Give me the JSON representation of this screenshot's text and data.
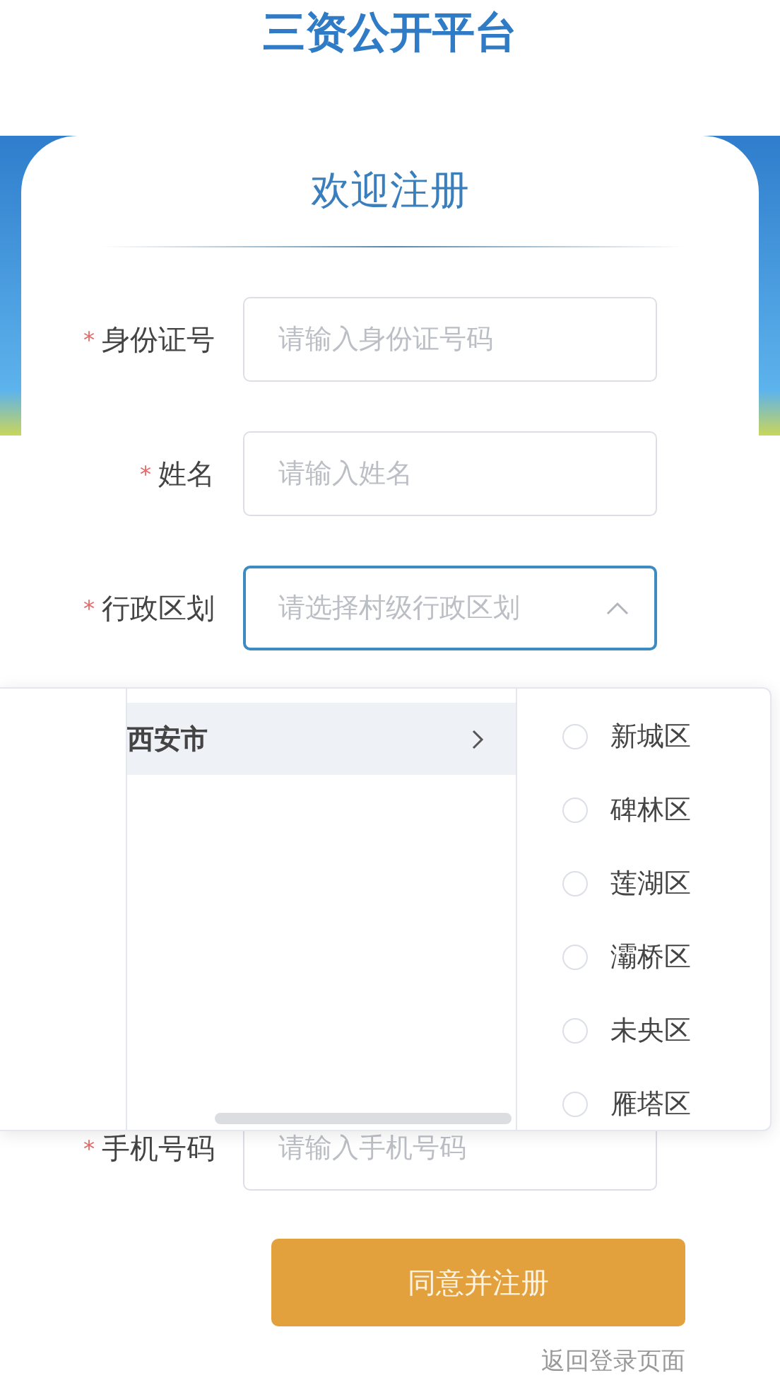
{
  "header": {
    "title": "三资公开平台"
  },
  "form": {
    "title": "欢迎注册",
    "fields": [
      {
        "label": "身份证号",
        "required_mark": "*",
        "kind": "input",
        "placeholder": "请输入身份证号码"
      },
      {
        "label": "姓名",
        "required_mark": "*",
        "kind": "input",
        "placeholder": "请输入姓名"
      },
      {
        "label": "行政区划",
        "required_mark": "*",
        "kind": "select",
        "placeholder": "请选择村级行政区划",
        "expanded": true
      },
      {
        "label": "手机号码",
        "required_mark": "*",
        "kind": "input",
        "placeholder": "请输入手机号码"
      }
    ],
    "submit": "同意并注册",
    "back_link": "返回登录页面"
  },
  "cascader": {
    "cities": [
      {
        "name": "西安市",
        "selected": true
      }
    ],
    "districts": [
      {
        "name": "新城区",
        "checked": false
      },
      {
        "name": "碑林区",
        "checked": false
      },
      {
        "name": "莲湖区",
        "checked": false
      },
      {
        "name": "灞桥区",
        "checked": false
      },
      {
        "name": "未央区",
        "checked": false
      },
      {
        "name": "雁塔区",
        "checked": false
      }
    ]
  }
}
